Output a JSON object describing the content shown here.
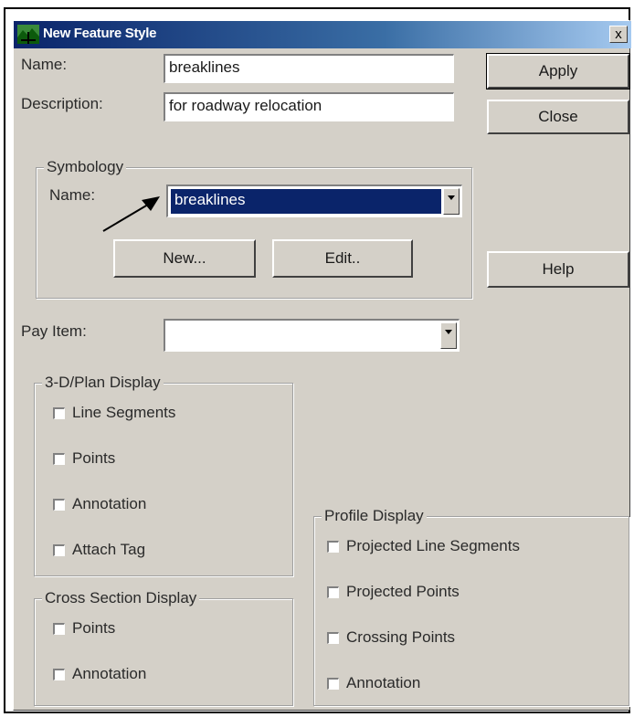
{
  "window": {
    "title": "New Feature Style",
    "close_glyph": "x"
  },
  "form": {
    "name_label": "Name:",
    "name_value": "breaklines",
    "description_label": "Description:",
    "description_value": "for roadway relocation",
    "pay_item_label": "Pay Item:",
    "pay_item_value": ""
  },
  "buttons": {
    "apply": "Apply",
    "close": "Close",
    "help": "Help",
    "new": "New...",
    "edit": "Edit.."
  },
  "symbology": {
    "legend": "Symbology",
    "name_label": "Name:",
    "name_value": "breaklines"
  },
  "plan_display": {
    "legend": "3-D/Plan Display",
    "items": [
      {
        "label": "Line Segments",
        "checked": false
      },
      {
        "label": "Points",
        "checked": false
      },
      {
        "label": "Annotation",
        "checked": false
      },
      {
        "label": "Attach Tag",
        "checked": false
      }
    ]
  },
  "cross_section_display": {
    "legend": "Cross Section Display",
    "items": [
      {
        "label": "Points",
        "checked": false
      },
      {
        "label": "Annotation",
        "checked": false
      }
    ]
  },
  "profile_display": {
    "legend": "Profile Display",
    "items": [
      {
        "label": "Projected Line Segments",
        "checked": false
      },
      {
        "label": "Projected Points",
        "checked": false
      },
      {
        "label": "Crossing Points",
        "checked": false
      },
      {
        "label": "Annotation",
        "checked": false
      }
    ]
  },
  "icons": {
    "app": "terrain-app-icon",
    "pointer": "pointer-arrow"
  },
  "colors": {
    "title_bar": "#0a246a",
    "dialog_face": "#d4d0c8",
    "selection": "#0a246a"
  }
}
